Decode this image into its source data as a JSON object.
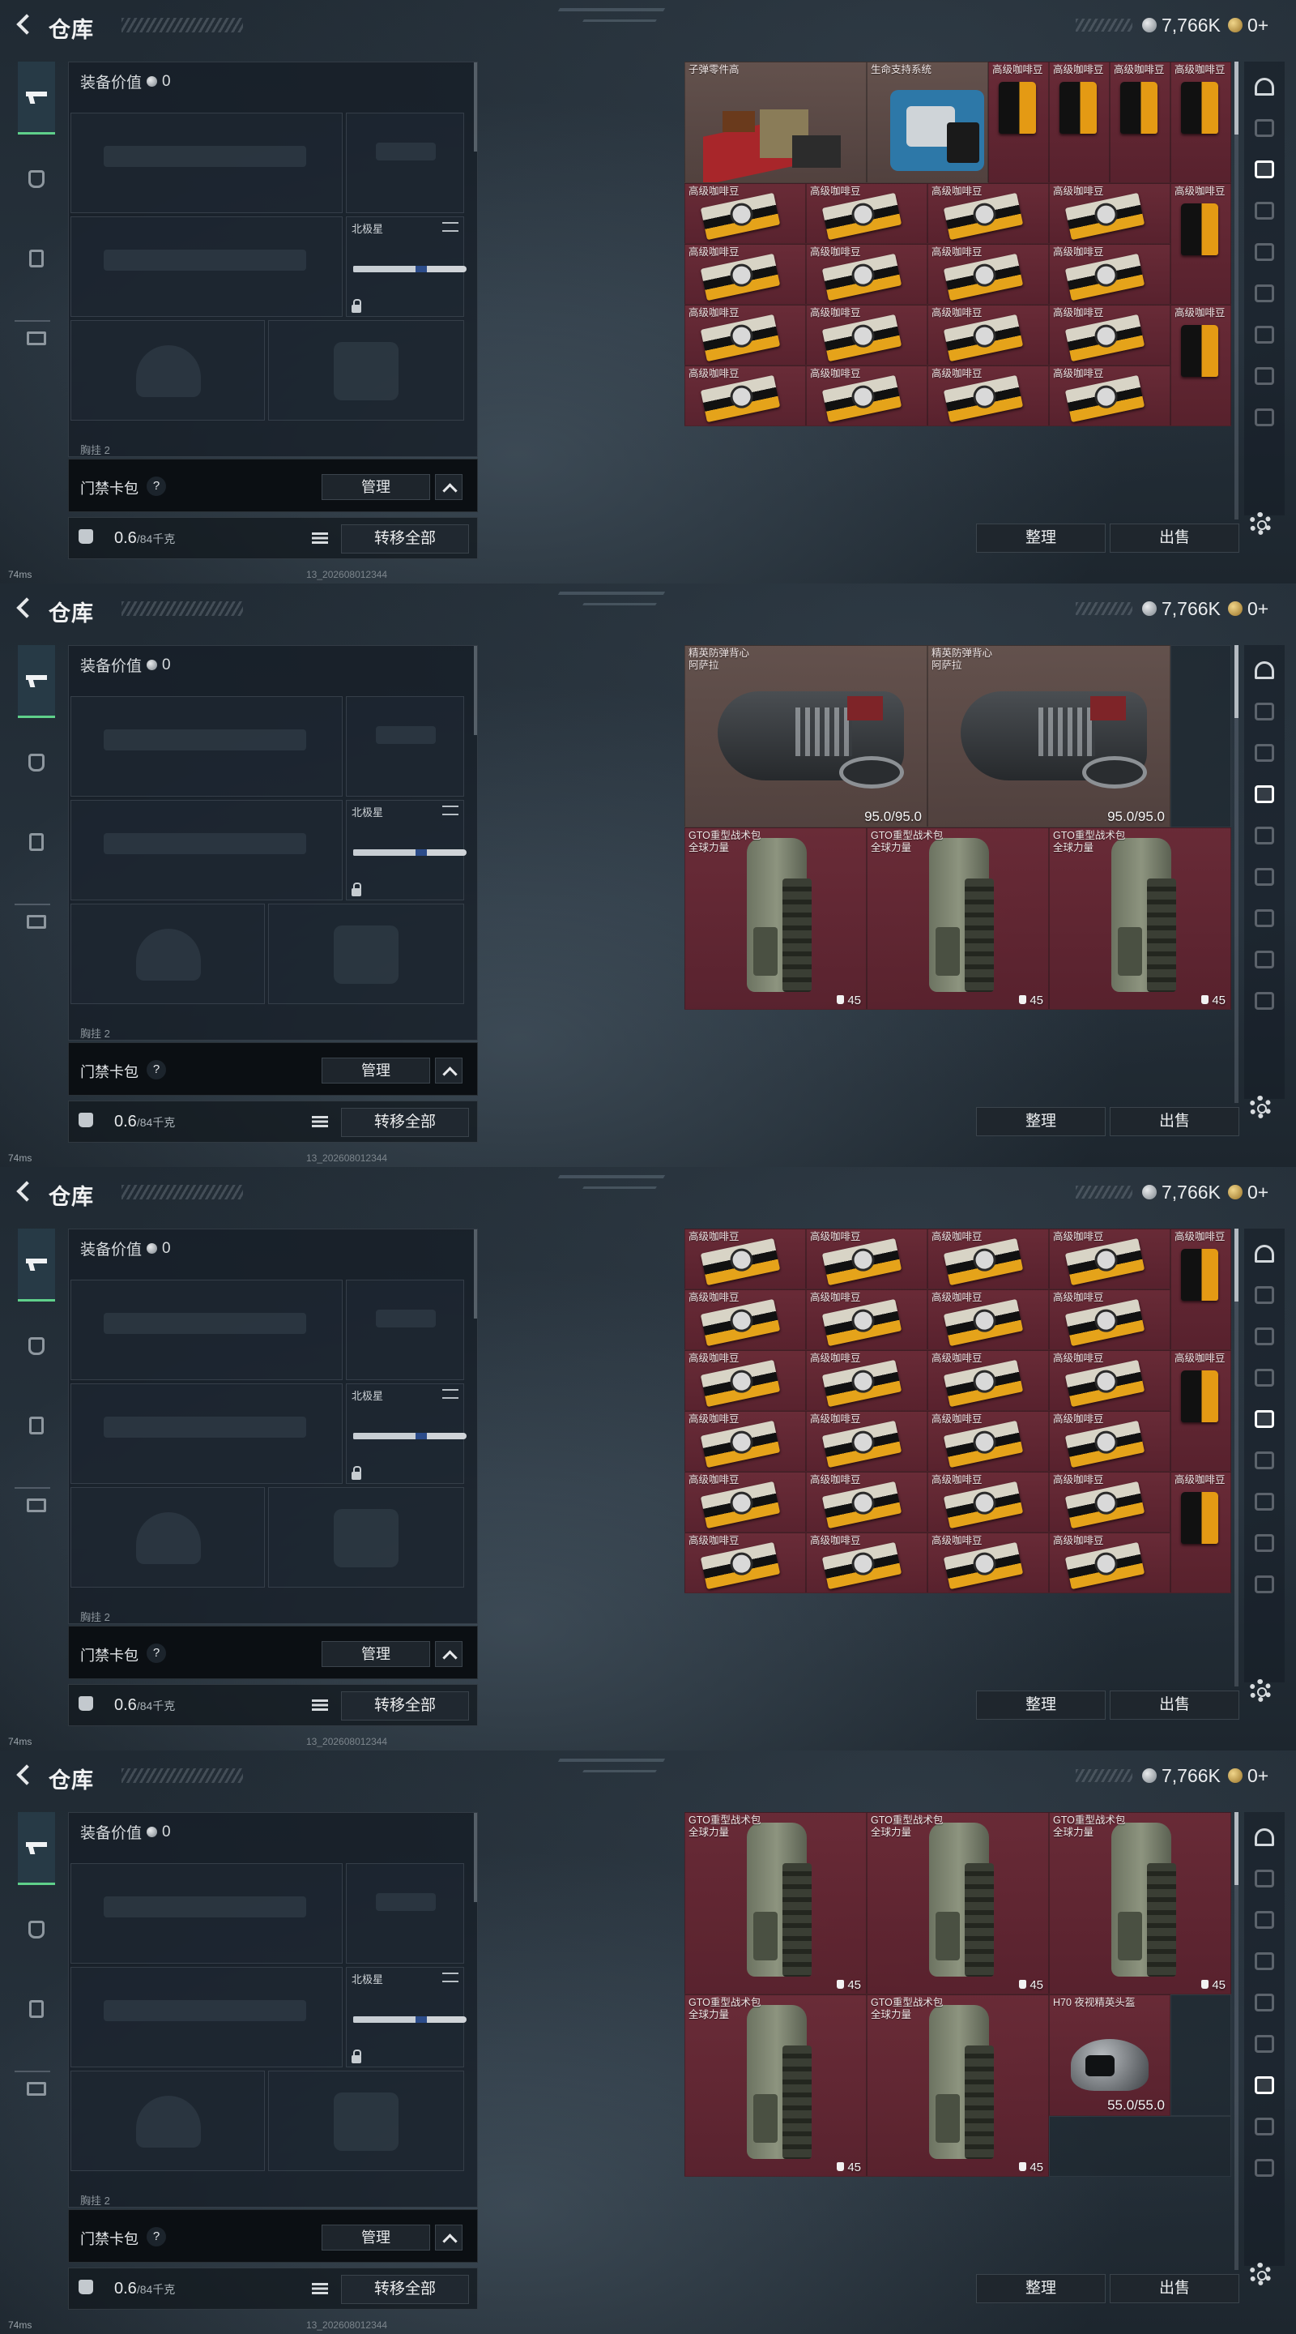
{
  "header": {
    "title": "仓库",
    "silver_amount": "7,766K",
    "gold_amount": "0+"
  },
  "equipment": {
    "value_label": "装备价值",
    "value": "0",
    "melee_label": "北极星",
    "truncated_label": "胸挂 2"
  },
  "keycard": {
    "label": "门禁卡包",
    "help": "?",
    "manage_label": "管理"
  },
  "weight": {
    "value": "0.6",
    "unit": "/84千克",
    "transfer_label": "转移全部"
  },
  "status": {
    "ping": "74ms",
    "build": "13_202608012344"
  },
  "grid_actions": {
    "sort_label": "整理",
    "sell_label": "出售"
  },
  "screens": [
    {
      "items": [
        {
          "name": "子弹零件高",
          "art": "parts",
          "color": "brown",
          "col": 0,
          "row": 0,
          "w": 3,
          "h": 2
        },
        {
          "name": "生命支持系统",
          "art": "life",
          "color": "brown",
          "col": 3,
          "row": 0,
          "w": 2,
          "h": 2
        },
        {
          "name": "高级咖啡豆",
          "art": "bag",
          "color": "red",
          "col": 5,
          "row": 0,
          "w": 1,
          "h": 2
        },
        {
          "name": "高级咖啡豆",
          "art": "bag",
          "color": "red",
          "col": 6,
          "row": 0,
          "w": 1,
          "h": 2
        },
        {
          "name": "高级咖啡豆",
          "art": "bag",
          "color": "red",
          "col": 7,
          "row": 0,
          "w": 1,
          "h": 2
        },
        {
          "name": "高级咖啡豆",
          "art": "bag",
          "color": "red",
          "col": 8,
          "row": 0,
          "w": 1,
          "h": 2
        },
        {
          "name": "高级咖啡豆",
          "art": "box",
          "color": "red",
          "col": 0,
          "row": 2,
          "w": 2,
          "h": 1
        },
        {
          "name": "高级咖啡豆",
          "art": "box",
          "color": "red",
          "col": 2,
          "row": 2,
          "w": 2,
          "h": 1
        },
        {
          "name": "高级咖啡豆",
          "art": "box",
          "color": "red",
          "col": 4,
          "row": 2,
          "w": 2,
          "h": 1
        },
        {
          "name": "高级咖啡豆",
          "art": "box",
          "color": "red",
          "col": 6,
          "row": 2,
          "w": 2,
          "h": 1
        },
        {
          "name": "高级咖啡豆",
          "art": "bag",
          "color": "red",
          "col": 8,
          "row": 2,
          "w": 1,
          "h": 2
        },
        {
          "name": "高级咖啡豆",
          "art": "box",
          "color": "red",
          "col": 0,
          "row": 3,
          "w": 2,
          "h": 1
        },
        {
          "name": "高级咖啡豆",
          "art": "box",
          "color": "red",
          "col": 2,
          "row": 3,
          "w": 2,
          "h": 1
        },
        {
          "name": "高级咖啡豆",
          "art": "box",
          "color": "red",
          "col": 4,
          "row": 3,
          "w": 2,
          "h": 1
        },
        {
          "name": "高级咖啡豆",
          "art": "box",
          "color": "red",
          "col": 6,
          "row": 3,
          "w": 2,
          "h": 1
        },
        {
          "name": "高级咖啡豆",
          "art": "box",
          "color": "red",
          "col": 0,
          "row": 4,
          "w": 2,
          "h": 1
        },
        {
          "name": "高级咖啡豆",
          "art": "box",
          "color": "red",
          "col": 2,
          "row": 4,
          "w": 2,
          "h": 1
        },
        {
          "name": "高级咖啡豆",
          "art": "box",
          "color": "red",
          "col": 4,
          "row": 4,
          "w": 2,
          "h": 1
        },
        {
          "name": "高级咖啡豆",
          "art": "box",
          "color": "red",
          "col": 6,
          "row": 4,
          "w": 2,
          "h": 1
        },
        {
          "name": "高级咖啡豆",
          "art": "bag",
          "color": "red",
          "col": 8,
          "row": 4,
          "w": 1,
          "h": 2
        },
        {
          "name": "高级咖啡豆",
          "art": "box",
          "color": "red",
          "col": 0,
          "row": 5,
          "w": 2,
          "h": 1
        },
        {
          "name": "高级咖啡豆",
          "art": "box",
          "color": "red",
          "col": 2,
          "row": 5,
          "w": 2,
          "h": 1
        },
        {
          "name": "高级咖啡豆",
          "art": "box",
          "color": "red",
          "col": 4,
          "row": 5,
          "w": 2,
          "h": 1
        },
        {
          "name": "高级咖啡豆",
          "art": "box",
          "color": "red",
          "col": 6,
          "row": 5,
          "w": 2,
          "h": 1
        }
      ]
    },
    {
      "items": [
        {
          "name": "精英防弹背心\n阿萨拉",
          "art": "vest",
          "color": "brown",
          "col": 0,
          "row": 0,
          "w": 4,
          "h": 3,
          "stat": "95.0/95.0"
        },
        {
          "name": "精英防弹背心\n阿萨拉",
          "art": "vest",
          "color": "brown",
          "col": 4,
          "row": 0,
          "w": 4,
          "h": 3,
          "stat": "95.0/95.0"
        },
        {
          "name": "",
          "art": "none",
          "color": "empty",
          "col": 8,
          "row": 0,
          "w": 1,
          "h": 3
        },
        {
          "name": "GTO重型战术包\n全球力量",
          "art": "backpack",
          "color": "red",
          "col": 0,
          "row": 3,
          "w": 3,
          "h": 3,
          "stat": "45",
          "stat_type": "bag"
        },
        {
          "name": "GTO重型战术包\n全球力量",
          "art": "backpack",
          "color": "red",
          "col": 3,
          "row": 3,
          "w": 3,
          "h": 3,
          "stat": "45",
          "stat_type": "bag"
        },
        {
          "name": "GTO重型战术包\n全球力量",
          "art": "backpack",
          "color": "red",
          "col": 6,
          "row": 3,
          "w": 3,
          "h": 3,
          "stat": "45",
          "stat_type": "bag"
        }
      ]
    },
    {
      "items": [
        {
          "name": "高级咖啡豆",
          "art": "box",
          "color": "red",
          "col": 0,
          "row": 0,
          "w": 2,
          "h": 1
        },
        {
          "name": "高级咖啡豆",
          "art": "box",
          "color": "red",
          "col": 2,
          "row": 0,
          "w": 2,
          "h": 1
        },
        {
          "name": "高级咖啡豆",
          "art": "box",
          "color": "red",
          "col": 4,
          "row": 0,
          "w": 2,
          "h": 1
        },
        {
          "name": "高级咖啡豆",
          "art": "box",
          "color": "red",
          "col": 6,
          "row": 0,
          "w": 2,
          "h": 1
        },
        {
          "name": "高级咖啡豆",
          "art": "bag",
          "color": "red",
          "col": 8,
          "row": 0,
          "w": 1,
          "h": 2
        },
        {
          "name": "高级咖啡豆",
          "art": "box",
          "color": "red",
          "col": 0,
          "row": 1,
          "w": 2,
          "h": 1
        },
        {
          "name": "高级咖啡豆",
          "art": "box",
          "color": "red",
          "col": 2,
          "row": 1,
          "w": 2,
          "h": 1
        },
        {
          "name": "高级咖啡豆",
          "art": "box",
          "color": "red",
          "col": 4,
          "row": 1,
          "w": 2,
          "h": 1
        },
        {
          "name": "高级咖啡豆",
          "art": "box",
          "color": "red",
          "col": 6,
          "row": 1,
          "w": 2,
          "h": 1
        },
        {
          "name": "高级咖啡豆",
          "art": "box",
          "color": "red",
          "col": 0,
          "row": 2,
          "w": 2,
          "h": 1
        },
        {
          "name": "高级咖啡豆",
          "art": "box",
          "color": "red",
          "col": 2,
          "row": 2,
          "w": 2,
          "h": 1
        },
        {
          "name": "高级咖啡豆",
          "art": "box",
          "color": "red",
          "col": 4,
          "row": 2,
          "w": 2,
          "h": 1
        },
        {
          "name": "高级咖啡豆",
          "art": "box",
          "color": "red",
          "col": 6,
          "row": 2,
          "w": 2,
          "h": 1
        },
        {
          "name": "高级咖啡豆",
          "art": "bag",
          "color": "red",
          "col": 8,
          "row": 2,
          "w": 1,
          "h": 2
        },
        {
          "name": "高级咖啡豆",
          "art": "box",
          "color": "red",
          "col": 0,
          "row": 3,
          "w": 2,
          "h": 1
        },
        {
          "name": "高级咖啡豆",
          "art": "box",
          "color": "red",
          "col": 2,
          "row": 3,
          "w": 2,
          "h": 1
        },
        {
          "name": "高级咖啡豆",
          "art": "box",
          "color": "red",
          "col": 4,
          "row": 3,
          "w": 2,
          "h": 1
        },
        {
          "name": "高级咖啡豆",
          "art": "box",
          "color": "red",
          "col": 6,
          "row": 3,
          "w": 2,
          "h": 1
        },
        {
          "name": "高级咖啡豆",
          "art": "box",
          "color": "red",
          "col": 0,
          "row": 4,
          "w": 2,
          "h": 1
        },
        {
          "name": "高级咖啡豆",
          "art": "box",
          "color": "red",
          "col": 2,
          "row": 4,
          "w": 2,
          "h": 1
        },
        {
          "name": "高级咖啡豆",
          "art": "box",
          "color": "red",
          "col": 4,
          "row": 4,
          "w": 2,
          "h": 1
        },
        {
          "name": "高级咖啡豆",
          "art": "box",
          "color": "red",
          "col": 6,
          "row": 4,
          "w": 2,
          "h": 1
        },
        {
          "name": "高级咖啡豆",
          "art": "bag",
          "color": "red",
          "col": 8,
          "row": 4,
          "w": 1,
          "h": 2
        },
        {
          "name": "高级咖啡豆",
          "art": "box",
          "color": "red",
          "col": 0,
          "row": 5,
          "w": 2,
          "h": 1
        },
        {
          "name": "高级咖啡豆",
          "art": "box",
          "color": "red",
          "col": 2,
          "row": 5,
          "w": 2,
          "h": 1
        },
        {
          "name": "高级咖啡豆",
          "art": "box",
          "color": "red",
          "col": 4,
          "row": 5,
          "w": 2,
          "h": 1
        },
        {
          "name": "高级咖啡豆",
          "art": "box",
          "color": "red",
          "col": 6,
          "row": 5,
          "w": 2,
          "h": 1
        }
      ]
    },
    {
      "items": [
        {
          "name": "GTO重型战术包\n全球力量",
          "art": "backpack",
          "color": "red",
          "col": 0,
          "row": 0,
          "w": 3,
          "h": 3,
          "stat": "45",
          "stat_type": "bag"
        },
        {
          "name": "GTO重型战术包\n全球力量",
          "art": "backpack",
          "color": "red",
          "col": 3,
          "row": 0,
          "w": 3,
          "h": 3,
          "stat": "45",
          "stat_type": "bag"
        },
        {
          "name": "GTO重型战术包\n全球力量",
          "art": "backpack",
          "color": "red",
          "col": 6,
          "row": 0,
          "w": 3,
          "h": 3,
          "stat": "45",
          "stat_type": "bag"
        },
        {
          "name": "GTO重型战术包\n全球力量",
          "art": "backpack",
          "color": "red",
          "col": 0,
          "row": 3,
          "w": 3,
          "h": 3,
          "stat": "45",
          "stat_type": "bag"
        },
        {
          "name": "GTO重型战术包\n全球力量",
          "art": "backpack",
          "color": "red",
          "col": 3,
          "row": 3,
          "w": 3,
          "h": 3,
          "stat": "45",
          "stat_type": "bag"
        },
        {
          "name": "H70 夜视精英头盔",
          "art": "helmet",
          "color": "red",
          "col": 6,
          "row": 3,
          "w": 2,
          "h": 2,
          "stat": "55.0/55.0"
        },
        {
          "name": "",
          "art": "none",
          "color": "empty",
          "col": 8,
          "row": 3,
          "w": 1,
          "h": 2
        },
        {
          "name": "",
          "art": "none",
          "color": "empty",
          "col": 6,
          "row": 5,
          "w": 3,
          "h": 1
        }
      ]
    }
  ],
  "right_rail": {
    "selected_per_screen": [
      2,
      3,
      4,
      6
    ]
  }
}
